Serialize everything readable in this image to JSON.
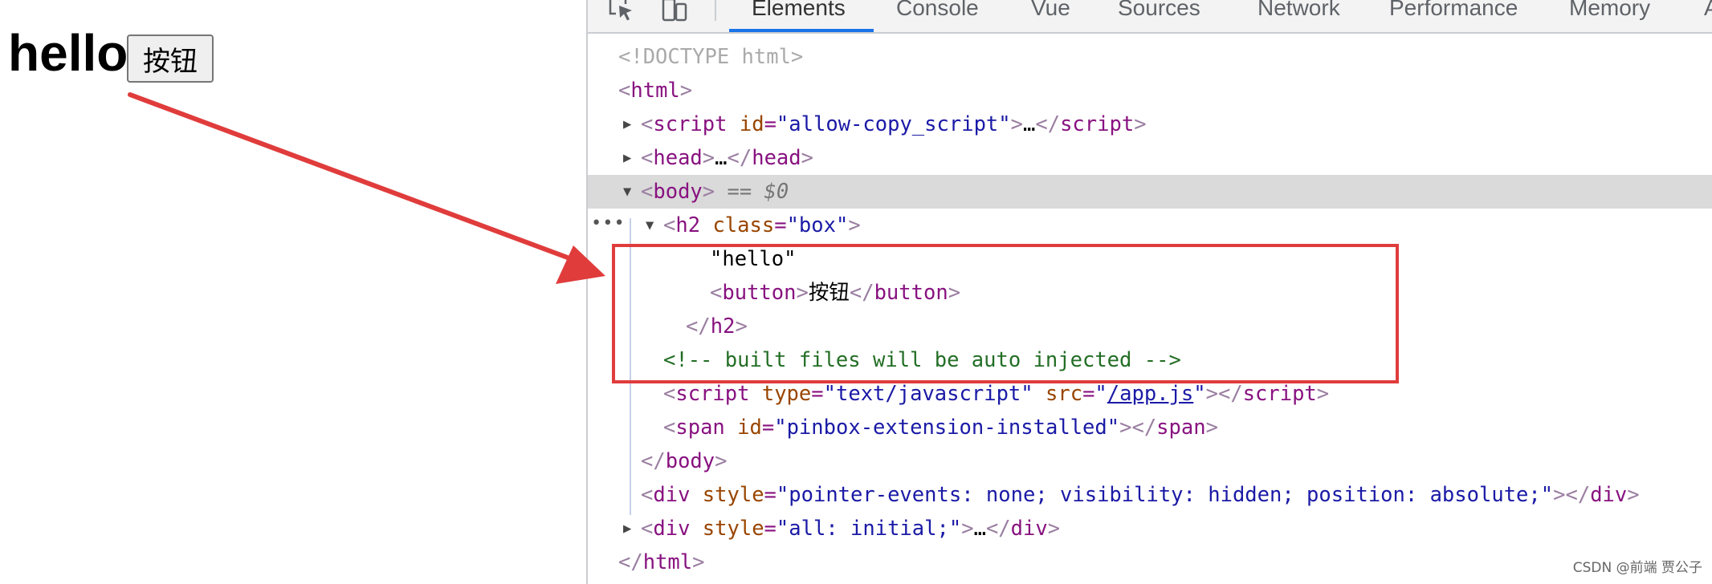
{
  "page": {
    "heading_text": "hello",
    "button_label": "按钮"
  },
  "devtools": {
    "tabs": [
      {
        "label": "Elements",
        "active": true
      },
      {
        "label": "Console",
        "active": false
      },
      {
        "label": "Vue",
        "active": false
      },
      {
        "label": "Sources",
        "active": false
      },
      {
        "label": "Network",
        "active": false
      },
      {
        "label": "Performance",
        "active": false
      },
      {
        "label": "Memory",
        "active": false
      },
      {
        "label": "A",
        "active": false
      }
    ],
    "toolbar_icons": [
      "inspect-element-icon",
      "device-toolbar-icon"
    ],
    "accent_color": "#1a73e8",
    "dom": {
      "doctype": "<!DOCTYPE html>",
      "html_open": "html",
      "script_tag": "script",
      "script_id_attr": "id",
      "script_id_value": "allow-copy_script",
      "collapsed_ellipsis": "…",
      "head_tag": "head",
      "body_tag": "body",
      "selected_marker": "== $0",
      "h2_tag": "h2",
      "h2_class_attr": "class",
      "h2_class_value": "box",
      "hello_text": "\"hello\"",
      "button_tag": "button",
      "button_text": "按钮",
      "comment": "<!-- built files will be auto injected -->",
      "script2_type_attr": "type",
      "script2_type_value": "text/javascript",
      "script2_src_attr": "src",
      "script2_src_value": "/app.js",
      "span_tag": "span",
      "span_id_attr": "id",
      "span_id_value": "pinbox-extension-installed",
      "div_tag": "div",
      "div1_style_attr": "style",
      "div1_style_value": "pointer-events: none; visibility: hidden; position: absolute;",
      "div2_style_attr": "style",
      "div2_style_value": "all: initial;"
    }
  },
  "annotation": {
    "arrow_color": "#e03c3c",
    "highlight_color": "#e03c3c"
  },
  "watermark": "CSDN @前端 贾公子"
}
